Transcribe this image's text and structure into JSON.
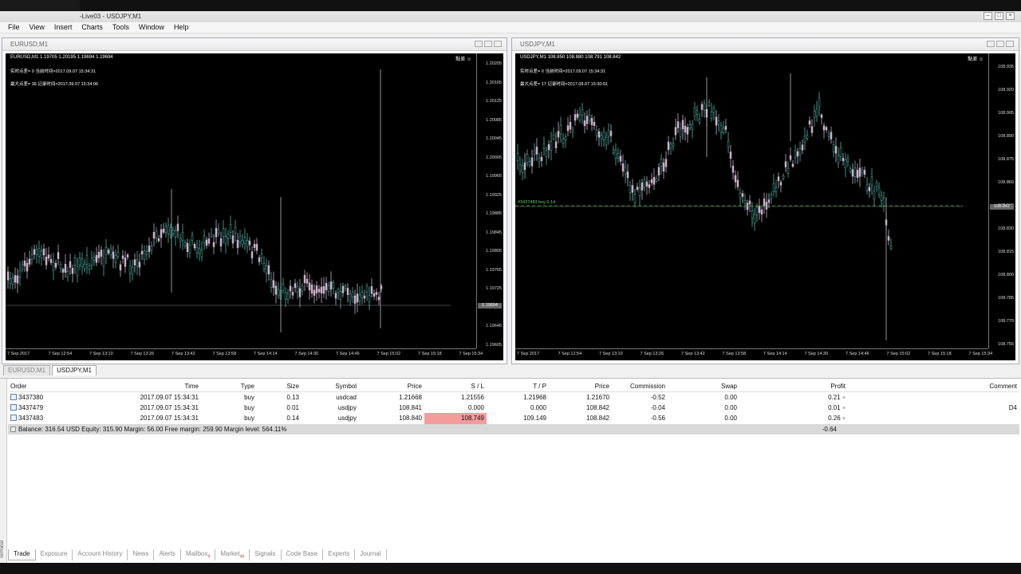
{
  "window": {
    "title": "-Live03 - USDJPY,M1"
  },
  "menu": [
    "File",
    "View",
    "Insert",
    "Charts",
    "Tools",
    "Window",
    "Help"
  ],
  "charts": [
    {
      "window_title": "EURUSD,M1",
      "ohlc": "EURUSD,M1  1.19705 1.20195 1.19694 1.19694",
      "info1": "实时点差= 0   当前时间=2017.09.07 15:34:31",
      "info2": "最大点差= 36   记录时间=2017.09.07 15:34:06",
      "corner": "點差 ☺",
      "price_ticks": [
        "1.20205",
        "1.20165",
        "1.20125",
        "1.20085",
        "1.20045",
        "1.20005",
        "1.19965",
        "1.19925",
        "1.19885",
        "1.19845",
        "1.19805",
        "1.19765",
        "1.19725",
        "1.19685",
        "1.19645",
        "1.19605"
      ],
      "current_price": "1.19694",
      "time_ticks": [
        "7 Sep 2017",
        "7 Sep 12:54",
        "7 Sep 13:10",
        "7 Sep 13:26",
        "7 Sep 13:42",
        "7 Sep 13:58",
        "7 Sep 14:14",
        "7 Sep 14:30",
        "7 Sep 14:46",
        "7 Sep 15:02",
        "7 Sep 15:18",
        "7 Sep 15:34"
      ],
      "trade_label": ""
    },
    {
      "window_title": "USDJPY,M1",
      "ohlc": "USDJPY,M1  108.850 108.880 108.791 108.842",
      "info1": "实时点差= 0   当前时间=2017.09.07 15:34:31",
      "info2": "最大点差= 17   记录时间=2017.09.07 15:30:01",
      "corner": "點差 ☺",
      "price_ticks": [
        "108.935",
        "108.920",
        "108.905",
        "108.890",
        "108.875",
        "108.860",
        "108.845",
        "108.830",
        "108.815",
        "108.800",
        "108.785",
        "108.770",
        "108.755"
      ],
      "current_price": "108.842",
      "time_ticks": [
        "7 Sep 2017",
        "7 Sep 12:54",
        "7 Sep 13:10",
        "7 Sep 13:26",
        "7 Sep 13:42",
        "7 Sep 13:58",
        "7 Sep 14:14",
        "7 Sep 14:30",
        "7 Sep 14:46",
        "7 Sep 15:02",
        "7 Sep 15:18",
        "7 Sep 15:34"
      ],
      "trade_label": "#3437483 buy 0.14"
    }
  ],
  "chart_tabs": [
    "EURUSD,M1",
    "USDJPY,M1"
  ],
  "terminal": {
    "side_label": "Terminal",
    "columns": [
      "Order",
      "Time",
      "Type",
      "Size",
      "Symbol",
      "Price",
      "S / L",
      "T / P",
      "Price",
      "Commission",
      "Swap",
      "Profit",
      "Comment"
    ],
    "rows": [
      {
        "order": "3437380",
        "time": "2017.09.07 15:34:31",
        "type": "buy",
        "size": "0.13",
        "symbol": "usdcad",
        "price": "1.21668",
        "sl": "1.21556",
        "tp": "1.21968",
        "cur_price": "1.21670",
        "commission": "-0.52",
        "swap": "0.00",
        "profit": "0.21",
        "comment": ""
      },
      {
        "order": "3437479",
        "time": "2017.09.07 15:34:31",
        "type": "buy",
        "size": "0.01",
        "symbol": "usdjpy",
        "price": "108.841",
        "sl": "0.000",
        "tp": "0.000",
        "cur_price": "108.842",
        "commission": "-0.04",
        "swap": "0.00",
        "profit": "0.01",
        "comment": "D4"
      },
      {
        "order": "3437483",
        "time": "2017.09.07 15:34:31",
        "type": "buy",
        "size": "0.14",
        "symbol": "usdjpy",
        "price": "108.840",
        "sl": "108.749",
        "tp": "109.149",
        "cur_price": "108.842",
        "commission": "-0.56",
        "swap": "0.00",
        "profit": "0.26",
        "comment": ""
      }
    ],
    "balance_text": "Balance: 316.54 USD  Equity: 315.90  Margin: 56.00  Free margin: 259.90  Margin level: 564.11%",
    "balance_profit": "-0.64",
    "tabs": [
      "Trade",
      "Exposure",
      "Account History",
      "News",
      "Alerts",
      "Mailbox",
      "Market",
      "Signals",
      "Code Base",
      "Experts",
      "Journal"
    ],
    "tab_badges": {
      "mailbox": "9",
      "market": "46"
    }
  },
  "colors": {
    "bull": "#4fb5a5",
    "bear": "#c9b0c9",
    "sl_highlight": "#f49b9b"
  }
}
